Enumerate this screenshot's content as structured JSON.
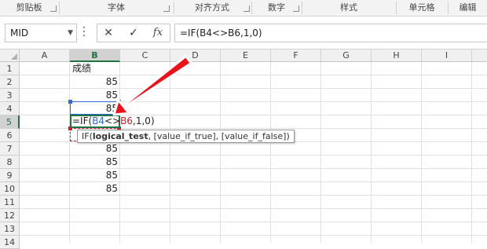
{
  "ribbon": {
    "groups": [
      "剪贴板",
      "字体",
      "对齐方式",
      "数字",
      "样式",
      "单元格",
      "编辑"
    ]
  },
  "name_box": {
    "value": "MID"
  },
  "formula_bar": {
    "cancel_icon": "✕",
    "enter_icon": "✓",
    "fx_label": "fx",
    "value": "=IF(B4<>B6,1,0)"
  },
  "columns": [
    "A",
    "B",
    "C",
    "D",
    "E",
    "F",
    "G",
    "H",
    "I"
  ],
  "active_column": "B",
  "rows": [
    "1",
    "2",
    "3",
    "4",
    "5",
    "6",
    "7",
    "8",
    "9",
    "10",
    "11",
    "12",
    "13",
    "14"
  ],
  "active_row": "5",
  "cells": {
    "B1": "成绩",
    "B2": "85",
    "B3": "85",
    "B4": "85",
    "B7": "85",
    "B8": "85",
    "B9": "85",
    "B10": "85"
  },
  "editing_cell": {
    "prefix": "=IF(",
    "ref1": "B4",
    "op": "<>",
    "ref2": "B6",
    "suffix": ",1,0)"
  },
  "tooltip": {
    "func": "IF(",
    "arg1": "logical_test",
    "rest": ", [value_if_true], [value_if_false])"
  },
  "colors": {
    "accent_green": "#217346",
    "ref_blue": "#2b6bd6",
    "ref_red": "#d11a2a",
    "arrow_red": "#e8141c"
  }
}
